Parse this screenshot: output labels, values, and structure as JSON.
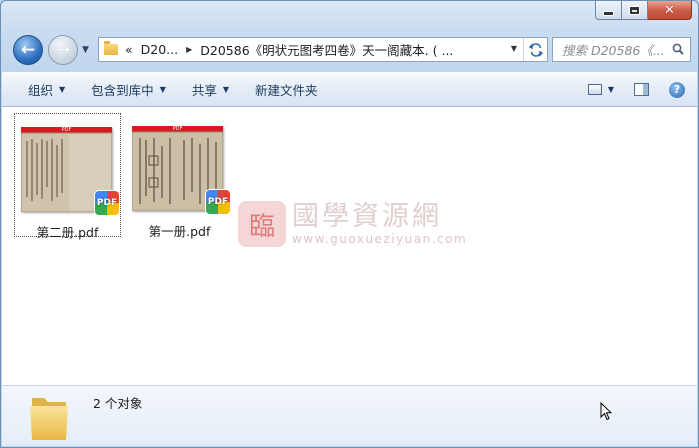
{
  "window": {
    "caption": {
      "minimize": "",
      "maximize": "",
      "close": "✕"
    }
  },
  "nav": {
    "back_glyph": "←",
    "forward_glyph": "→",
    "address": {
      "overflow": "«",
      "crumb_1": "D20...",
      "crumb_2": "D20586《明状元图考四卷》天一阁藏本. ( ..."
    },
    "search": {
      "placeholder": "搜索 D20586《..."
    }
  },
  "toolbar": {
    "organize": "组织",
    "include_in_library": "包含到库中",
    "share": "共享",
    "new_folder": "新建文件夹"
  },
  "files": [
    {
      "name": "第二册.pdf",
      "badge": "PDF",
      "banner": "PDF",
      "selected": true
    },
    {
      "name": "第一册.pdf",
      "badge": "PDF",
      "banner": "PDF",
      "selected": false
    }
  ],
  "watermark": {
    "seal": "臨",
    "text": "國學資源網",
    "url": "www.guoxueziyuan.com"
  },
  "status": {
    "count": "2 个对象"
  },
  "icons": {
    "back": "back-arrow-icon",
    "forward": "forward-arrow-icon",
    "folder": "folder-icon",
    "refresh": "refresh-icon",
    "search": "search-icon",
    "view": "view-options-icon",
    "preview_pane": "preview-pane-icon",
    "help": "help-icon"
  }
}
